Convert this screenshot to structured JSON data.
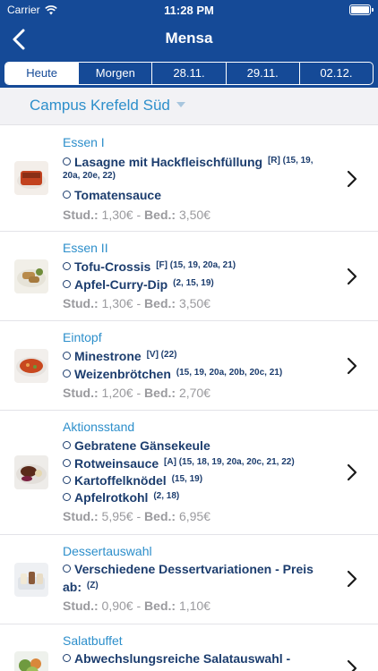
{
  "status": {
    "carrier": "Carrier",
    "time": "11:28 PM"
  },
  "nav": {
    "title": "Mensa"
  },
  "tabs": [
    "Heute",
    "Morgen",
    "28.11.",
    "29.11.",
    "02.12."
  ],
  "campus": "Campus Krefeld Süd",
  "menu": [
    {
      "category": "Essen I",
      "items": [
        {
          "name": "Lasagne mit Hackfleischfüllung",
          "tags": "[R] (15, 19,",
          "tags2": "20a, 20e, 22)"
        },
        {
          "name": "Tomatensauce",
          "tags": ""
        }
      ],
      "stud_label": "Stud.:",
      "stud_price": "1,30€",
      "bed_label": "Bed.:",
      "bed_price": "3,50€"
    },
    {
      "category": "Essen II",
      "items": [
        {
          "name": "Tofu-Crossis",
          "tags": "[F] (15, 19, 20a, 21)"
        },
        {
          "name": "Apfel-Curry-Dip",
          "tags": "(2, 15, 19)"
        }
      ],
      "stud_label": "Stud.:",
      "stud_price": "1,30€",
      "bed_label": "Bed.:",
      "bed_price": "3,50€"
    },
    {
      "category": "Eintopf",
      "items": [
        {
          "name": "Minestrone",
          "tags": "[V] (22)"
        },
        {
          "name": "Weizenbrötchen",
          "tags": "(15, 19, 20a, 20b, 20c, 21)"
        }
      ],
      "stud_label": "Stud.:",
      "stud_price": "1,20€",
      "bed_label": "Bed.:",
      "bed_price": "2,70€"
    },
    {
      "category": "Aktionsstand",
      "items": [
        {
          "name": "Gebratene Gänsekeule",
          "tags": ""
        },
        {
          "name": "Rotweinsauce",
          "tags": "[A] (15, 18, 19, 20a, 20c, 21, 22)"
        },
        {
          "name": "Kartoffelknödel",
          "tags": "(15, 19)"
        },
        {
          "name": "Apfelrotkohl",
          "tags": "(2, 18)"
        }
      ],
      "stud_label": "Stud.:",
      "stud_price": "5,95€",
      "bed_label": "Bed.:",
      "bed_price": "6,95€"
    },
    {
      "category": "Dessertauswahl",
      "items": [
        {
          "name": "Verschiedene Dessertvariationen - Preis",
          "name2": "ab:",
          "tags": "(Z)"
        }
      ],
      "stud_label": "Stud.:",
      "stud_price": "0,90€",
      "bed_label": "Bed.:",
      "bed_price": "1,10€"
    },
    {
      "category": "Salatbuffet",
      "items": [
        {
          "name": "Abwechslungsreiche Salatauswahl -",
          "tags": ""
        }
      ]
    }
  ]
}
